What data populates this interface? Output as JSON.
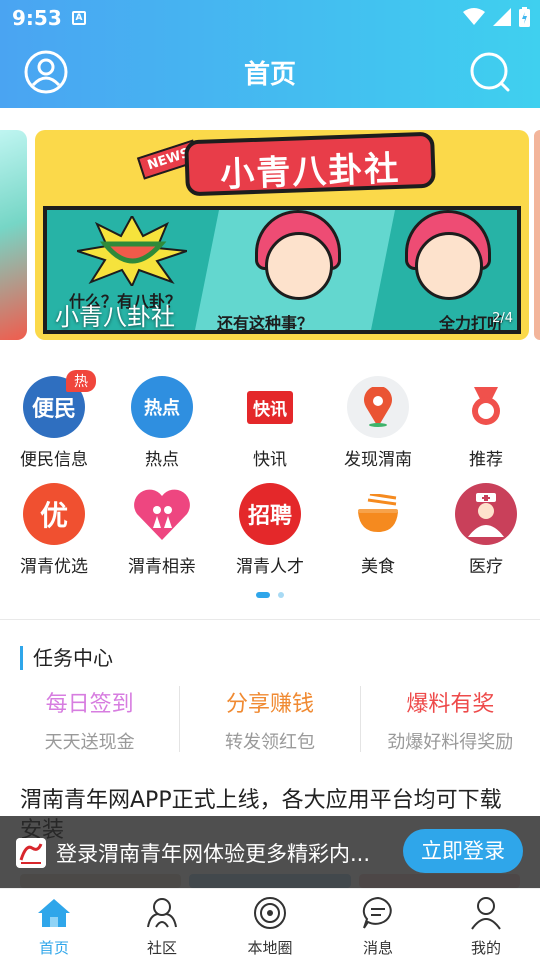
{
  "status_bar": {
    "time": "9:53",
    "notification_icon": "A"
  },
  "header": {
    "title": "首页"
  },
  "banner": {
    "title": "小青八卦社",
    "news_tag": "NEWS",
    "caption_left": "什么？有八卦？",
    "caption_mid": "还有这种事？",
    "caption_right": "全力打听",
    "overlay_title": "小青八卦社",
    "pager": "2/4"
  },
  "grid": {
    "rows": [
      [
        {
          "label": "便民信息",
          "icon_text": "便民",
          "icon": "convenience-icon",
          "badge": "热",
          "color": "#2f6fc0"
        },
        {
          "label": "热点",
          "icon_text": "热点",
          "icon": "hot-search-icon",
          "color": "#2f8fe0"
        },
        {
          "label": "快讯",
          "icon_text": "快讯",
          "icon": "newsflash-icon",
          "color": "#e4282a"
        },
        {
          "label": "发现渭南",
          "icon_text": "",
          "icon": "map-pin-icon",
          "color": "#ea5433"
        },
        {
          "label": "推荐",
          "icon_text": "",
          "icon": "medal-icon",
          "color": "#f0514c"
        }
      ],
      [
        {
          "label": "渭青优选",
          "icon_text": "优",
          "icon": "select-icon",
          "color": "#f05030"
        },
        {
          "label": "渭青相亲",
          "icon_text": "",
          "icon": "heart-couple-icon",
          "color": "#ee4680"
        },
        {
          "label": "渭青人才",
          "icon_text": "招聘",
          "icon": "recruit-icon",
          "color": "#e4282a"
        },
        {
          "label": "美食",
          "icon_text": "",
          "icon": "noodle-bowl-icon",
          "color": "#f58a1f"
        },
        {
          "label": "医疗",
          "icon_text": "",
          "icon": "nurse-icon",
          "color": "#c9405a"
        }
      ]
    ]
  },
  "task_center": {
    "title": "任务中心",
    "tasks": [
      {
        "title": "每日签到",
        "subtitle": "天天送现金",
        "color": "#d77de0"
      },
      {
        "title": "分享赚钱",
        "subtitle": "转发领红包",
        "color": "#f08a32"
      },
      {
        "title": "爆料有奖",
        "subtitle": "劲爆好料得奖励",
        "color": "#ee4a4a"
      }
    ]
  },
  "headline": "渭南青年网APP正式上线，各大应用平台均可下载安装",
  "login_bar": {
    "text": "登录渭南青年网体验更多精彩内...",
    "button": "立即登录"
  },
  "tabbar": {
    "tabs": [
      {
        "label": "首页",
        "icon": "home-icon",
        "active": true
      },
      {
        "label": "社区",
        "icon": "community-icon",
        "active": false
      },
      {
        "label": "本地圈",
        "icon": "local-circle-icon",
        "active": false
      },
      {
        "label": "消息",
        "icon": "message-icon",
        "active": false
      },
      {
        "label": "我的",
        "icon": "profile-icon",
        "active": false
      }
    ]
  }
}
